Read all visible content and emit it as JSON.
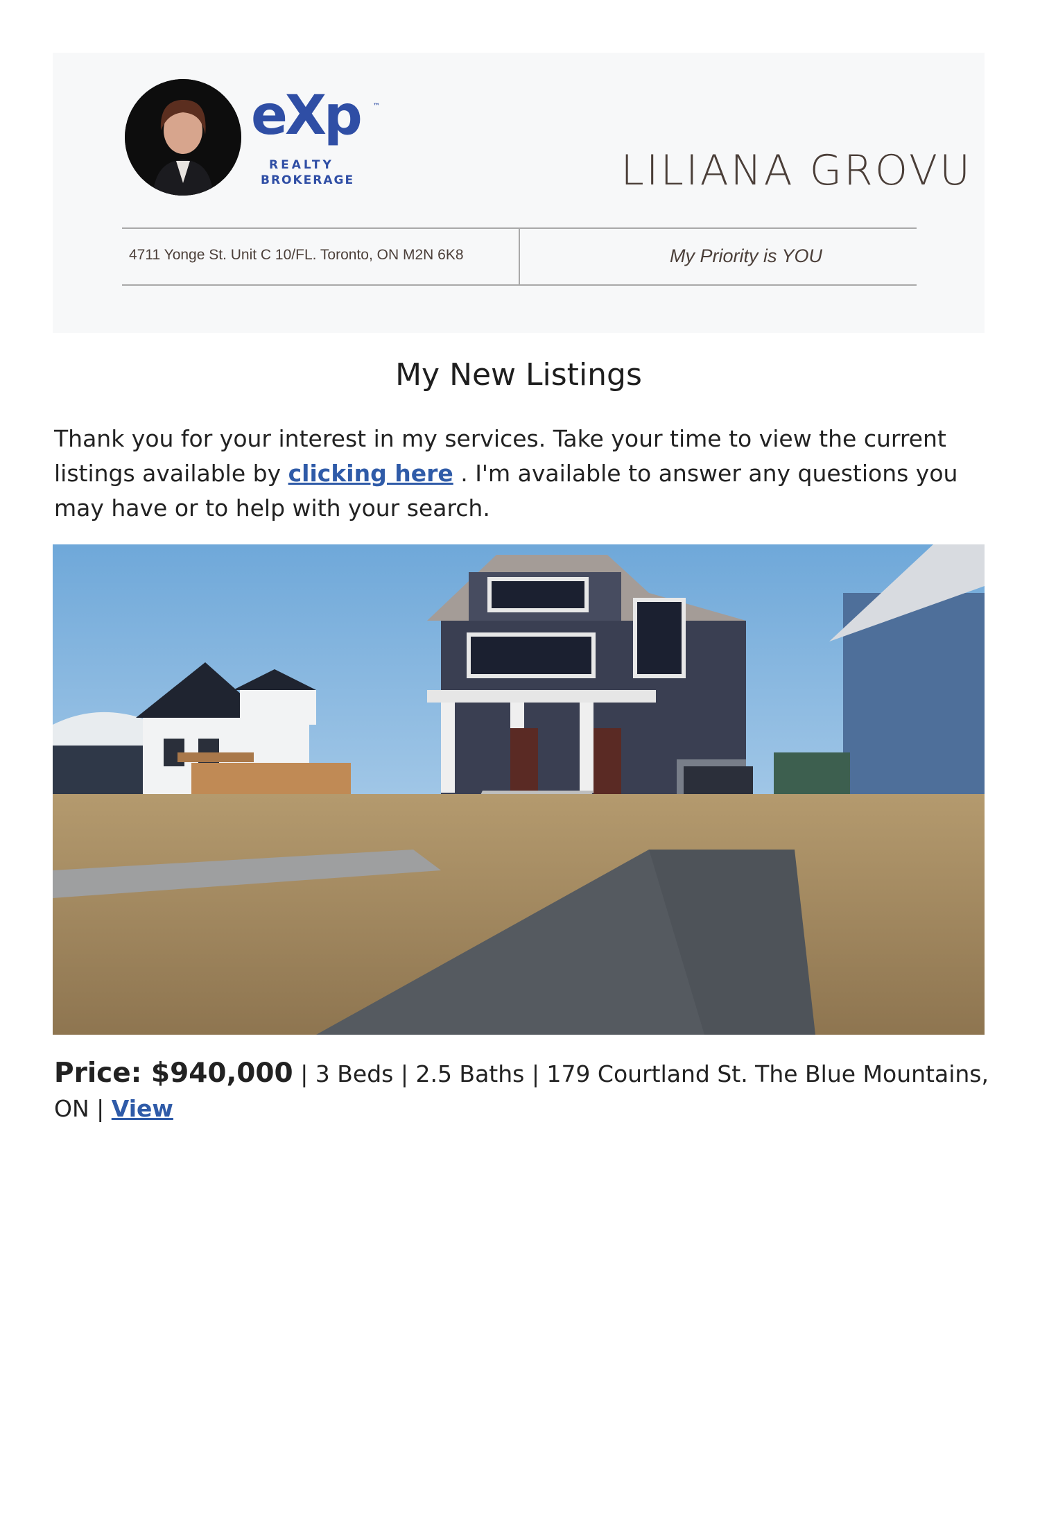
{
  "header": {
    "agent_name": "LILIANA GROVU",
    "brand": {
      "exp": "eXp",
      "tm": "™",
      "realty": "REALTY",
      "brokerage": "BROKERAGE"
    },
    "address": "4711 Yonge St. Unit C 10/FL. Toronto, ON M2N 6K8",
    "tagline": "My Priority is YOU"
  },
  "main": {
    "title": "My New Listings",
    "intro_before": "Thank you for your interest in my services.  Take your time to view the current listings available by ",
    "intro_link": "clicking here",
    "intro_after": " .  I'm available to answer any questions you may have or to help with your search."
  },
  "listing": {
    "price_label": "Price: $940,000",
    "details": " | 3 Beds | 2.5 Baths | 179 Courtland St. The Blue Mountains, ON | ",
    "view_link": "View"
  },
  "colors": {
    "brand_blue": "#2f4ea5",
    "link_blue": "#2f5ba8",
    "name_brown": "#4a3e38"
  }
}
